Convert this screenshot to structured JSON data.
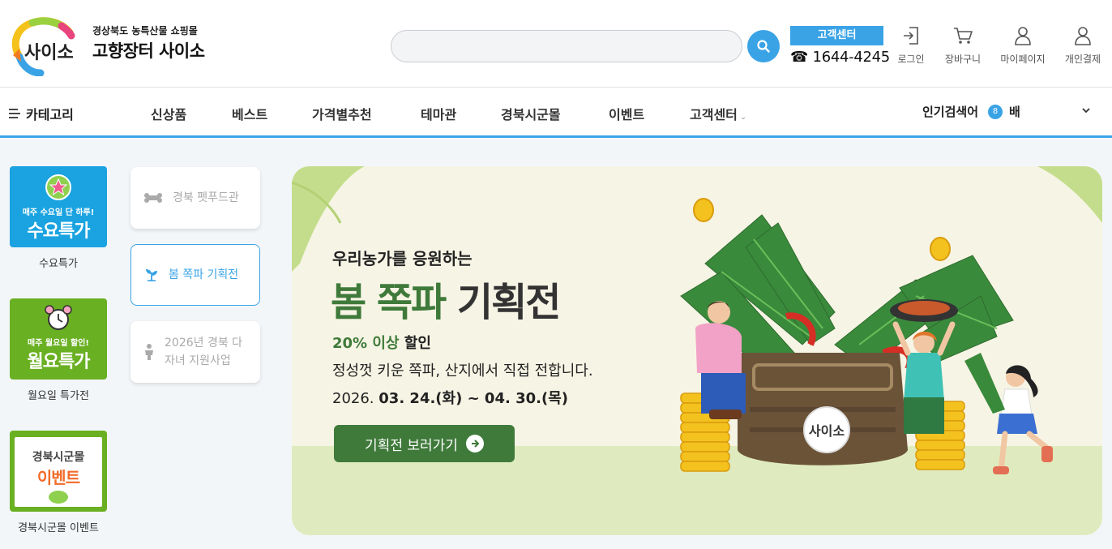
{
  "header": {
    "logo_word": "사이소",
    "logo_subtitle": "경상북도 농특산물 쇼핑몰",
    "logo_title": "고향장터 사이소",
    "search": {
      "placeholder": "",
      "value": ""
    },
    "customer_center": {
      "label": "고객센터",
      "phone": "☎ 1644-4245"
    },
    "utils": [
      {
        "label": "로그인",
        "icon": "login-icon"
      },
      {
        "label": "장바구니",
        "icon": "cart-icon"
      },
      {
        "label": "마이페이지",
        "icon": "user-icon"
      },
      {
        "label": "개인결제",
        "icon": "user-icon"
      }
    ]
  },
  "nav": {
    "category_label": "카테고리",
    "menu": [
      "신상품",
      "베스트",
      "가격별추천",
      "테마관",
      "경북시군몰",
      "이벤트",
      "고객센터"
    ],
    "menu_chevron": "⌄",
    "popular": {
      "label": "인기검색어",
      "rank": "8",
      "keyword": "배"
    }
  },
  "quick_links": [
    {
      "tile_small": "매주 수요일 단 하루!",
      "tile_big": "수요특가",
      "caption": "수요특가",
      "color": "#1aa3e0"
    },
    {
      "tile_small": "매주 월요일 할인!",
      "tile_big": "월요특가",
      "caption": "월요일 특가전",
      "color": "#6ab023"
    },
    {
      "tile_small": "경북시군몰",
      "tile_big": "이벤트",
      "caption": "경북시군몰 이벤트",
      "color": "#6ab023"
    }
  ],
  "cards": [
    {
      "label": "경북 펫푸드관",
      "icon": "bone-icon",
      "active": false
    },
    {
      "label": "봄 쪽파 기획전",
      "icon": "sprout-icon",
      "active": true
    },
    {
      "label": "2026년 경북 다자녀 지원사업",
      "icon": "person-icon",
      "active": false
    }
  ],
  "banner": {
    "subtitle": "우리농가를 응원하는",
    "title_green": "봄 쪽파",
    "title_dark": "기획전",
    "discount_green": "20% 이상",
    "discount_rest": "할인",
    "description": "정성껏 키운 쪽파, 산지에서 직접 전합니다.",
    "date_prefix": "2026.",
    "date_bold": "03. 24.(화) ~ 04. 30.(목)",
    "cta_label": "기획전 보러가기",
    "basket_logo": "사이소"
  },
  "colors": {
    "accent": "#3aa3e6",
    "green": "#3f7a3a",
    "banner_bg": "#f6f4e4"
  }
}
